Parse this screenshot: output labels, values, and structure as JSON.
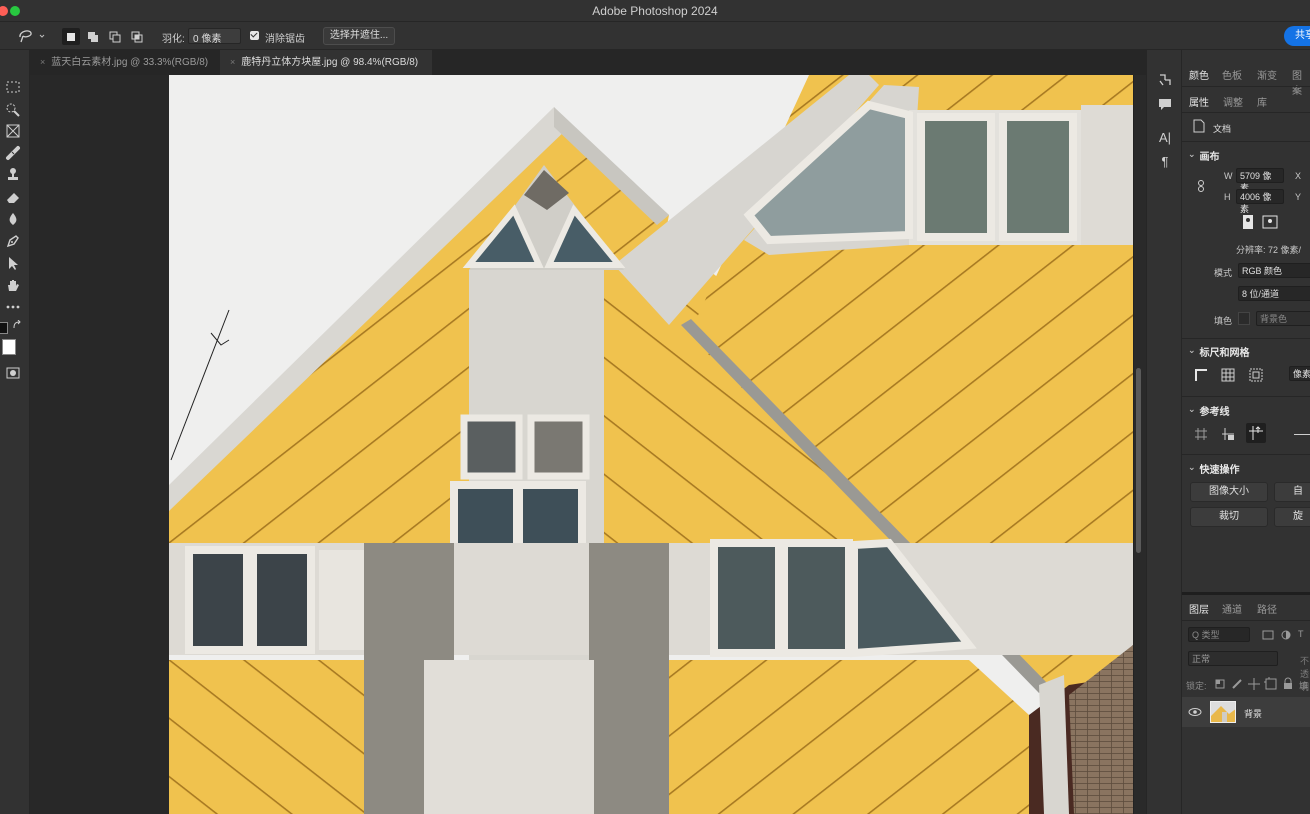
{
  "window": {
    "title": "Adobe Photoshop 2024",
    "traffic_colors": [
      "#ff5f57",
      "#28c840"
    ]
  },
  "options_bar": {
    "feather_label": "羽化:",
    "feather_value": "0 像素",
    "antialias_label": "消除锯齿",
    "antialias_checked": true,
    "select_mask_label": "选择并遮住...",
    "share_label": "共享"
  },
  "tabs": [
    {
      "label": "蓝天白云素材.jpg @ 33.3%(RGB/8)",
      "active": false
    },
    {
      "label": "鹿特丹立体方块屋.jpg @ 98.4%(RGB/8)",
      "active": true
    }
  ],
  "panel": {
    "top_tabs": [
      "颜色",
      "色板",
      "渐变",
      "图案"
    ],
    "sub_tabs": [
      "属性",
      "调整",
      "库"
    ],
    "doc_label": "文档",
    "canvas_section": "画布",
    "w_label": "W",
    "w_value": "5709 像素",
    "h_label": "H",
    "h_value": "4006 像素",
    "x_label": "X",
    "y_label": "Y",
    "resolution": "分辨率: 72 像素/",
    "mode_label": "模式",
    "mode_value": "RGB 颜色",
    "depth_value": "8 位/通道",
    "fill_label": "填色",
    "fill_value": "背景色",
    "rulers_section": "标尺和网格",
    "units_value": "像素",
    "guides_section": "参考线",
    "quick_section": "快速操作",
    "image_size_btn": "图像大小",
    "crop_btn": "裁切",
    "btn_b_partial": "自",
    "btn_d_partial": "旋"
  },
  "layers_panel": {
    "tabs": [
      "图层",
      "通道",
      "路径"
    ],
    "filter_placeholder": "Q 类型",
    "blend_mode": "正常",
    "opacity_label": "不透明",
    "lock_label": "锁定:",
    "fill_label": "填",
    "layers": [
      {
        "name": "背景",
        "visible": true
      }
    ]
  },
  "colors": {
    "accent": "#1473e6",
    "facade_yellow": "#f0c24e",
    "panel_grey": "#d7d5d0"
  }
}
